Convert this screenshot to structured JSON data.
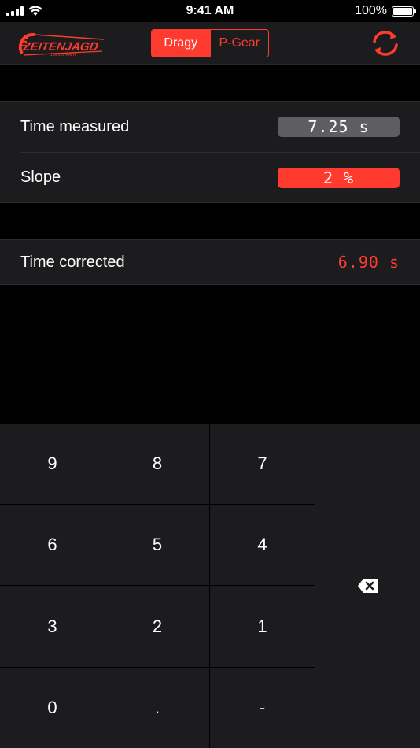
{
  "status_bar": {
    "time": "9:41 AM",
    "battery_percent": "100%"
  },
  "nav": {
    "segments": [
      {
        "label": "Dragy",
        "active": true
      },
      {
        "label": "P-Gear",
        "active": false
      }
    ],
    "logo_text": "ZEITENJAGD",
    "logo_subtext": "100-200 KM/H",
    "accent_color": "#ff3b30"
  },
  "measurements": {
    "time_measured": {
      "label": "Time measured",
      "value": "7.25 s"
    },
    "slope": {
      "label": "Slope",
      "value": "2 %"
    }
  },
  "result": {
    "time_corrected": {
      "label": "Time corrected",
      "value": "6.90 s"
    }
  },
  "keypad": {
    "keys": [
      "9",
      "8",
      "7",
      "6",
      "5",
      "4",
      "3",
      "2",
      "1",
      "0",
      ".",
      "-"
    ],
    "backspace_icon": "backspace-icon"
  }
}
